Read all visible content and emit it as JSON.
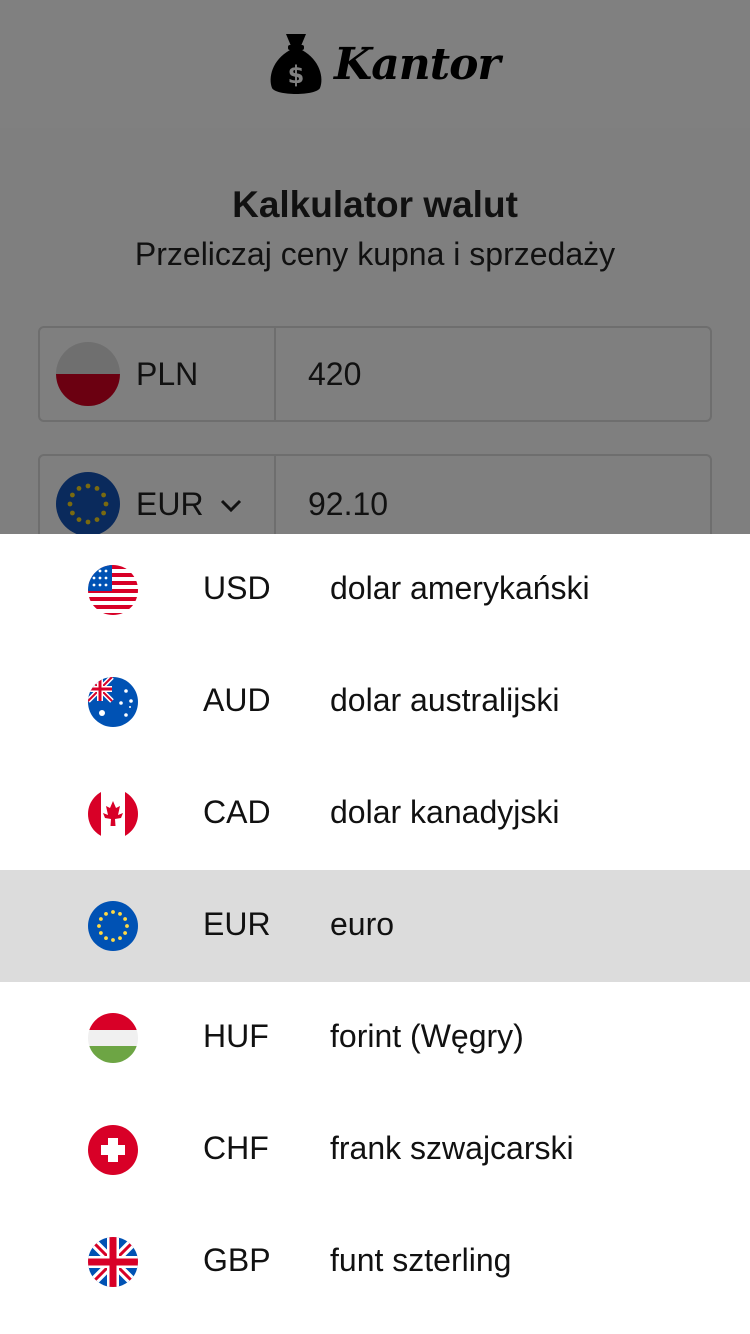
{
  "header": {
    "brand": "Kantor",
    "logo_icon": "money-bag-icon"
  },
  "calculator": {
    "title": "Kalkulator walut",
    "subtitle": "Przeliczaj ceny kupna i sprzedaży",
    "from": {
      "code": "PLN",
      "value": "420",
      "flag_icon": "poland-flag-icon"
    },
    "to": {
      "code": "EUR",
      "value": "92.10",
      "flag_icon": "eu-flag-icon",
      "chevron_icon": "chevron-down-icon"
    }
  },
  "dropdown": {
    "items": [
      {
        "code": "USD",
        "name": "dolar amerykański",
        "flag_icon": "usa-flag-icon"
      },
      {
        "code": "AUD",
        "name": "dolar australijski",
        "flag_icon": "australia-flag-icon"
      },
      {
        "code": "CAD",
        "name": "dolar kanadyjski",
        "flag_icon": "canada-flag-icon"
      },
      {
        "code": "EUR",
        "name": "euro",
        "flag_icon": "eu-flag-icon",
        "selected": true
      },
      {
        "code": "HUF",
        "name": "forint (Węgry)",
        "flag_icon": "hungary-flag-icon"
      },
      {
        "code": "CHF",
        "name": "frank szwajcarski",
        "flag_icon": "switzerland-flag-icon"
      },
      {
        "code": "GBP",
        "name": "funt szterling",
        "flag_icon": "uk-flag-icon"
      }
    ]
  },
  "colors": {
    "overlay": "#7f7f7f",
    "selected_row": "#dcdcdc",
    "list_bg": "#ffffff"
  }
}
